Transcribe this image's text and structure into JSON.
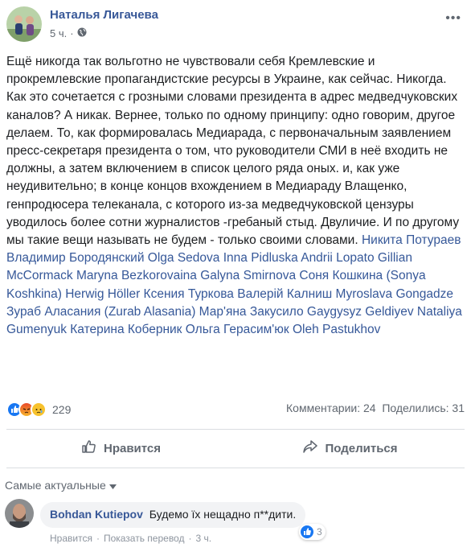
{
  "post": {
    "author": "Наталья Лигачева",
    "time": "5 ч.",
    "dot": "·",
    "more": "•••",
    "text": "Ещё никогда так вольготно не чувствовали себя Кремлевские и прокремлевские пропагандистские ресурсы в Украине, как сейчас. Никогда. Как это сочетается с грозными словами президента в адрес медведчуковских каналов? А никак. Вернее, только по одному принципу: одно говорим, другое делаем. То, как формировалась Медиарада, с первоначальным заявлением пресс-секретаря президента о том, что руководители СМИ в неё входить не должны, а затем включением в список целого ряда оных. и, как уже неудивительно; в конце концов вхождением в Медиараду Влащенко, генпродюсера телеканала, с которого из-за медведчуковской цензуры уводилось более сотни журналистов -гребаный стыд. Двуличие. И по другому мы такие вещи называть не будем - только своими словами.",
    "tags": "Никита Потураев Владимир Бородянский Olga Sedova Inna Pidluska Andrii Lopato Gillian McCormack Maryna Bezkorovaina Galyna Smirnova Соня Кошкина (Sonya Koshkina) Herwig Höller Ксения Туркова Валерій Калниш Myroslava Gongadze Зураб Аласания (Zurab Alasania) Мар'яна Закусило Gaygysyz Geldiyev Nataliya Gumenyuk Катерина Коберник Ольга Герасим'юк Oleh Pastukhov"
  },
  "reactions": {
    "count": "229",
    "comments": "Комментарии: 24",
    "shares": "Поделились: 31"
  },
  "actions": {
    "like": "Нравится",
    "share": "Поделиться"
  },
  "comments": {
    "sort_label": "Самые актуальные",
    "items": [
      {
        "name": "Bohdan Kutiepov",
        "text": "Будемо їх нещадно п**дити.",
        "reactions": "3",
        "like": "Нравится",
        "translate": "Показать перевод",
        "time": "3 ч.",
        "dot": "·"
      }
    ]
  },
  "colors": {
    "link": "#385898",
    "like_blue": "#1877f2",
    "angry": "#f0612a",
    "sad": "#f7c22d"
  }
}
